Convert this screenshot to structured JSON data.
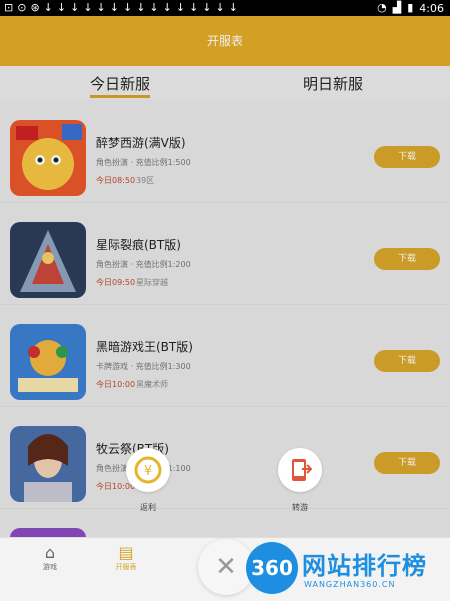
{
  "status_bar": {
    "time": "4:06"
  },
  "app_bar": {
    "title": "开服表"
  },
  "tabs": [
    {
      "label": "今日新服",
      "active": true
    },
    {
      "label": "明日新服",
      "active": false
    }
  ],
  "games": [
    {
      "name": "醉梦西游(满V版)",
      "subtitle": "角色扮演 · 充值比例1:500",
      "time": "今日08:50",
      "server": "39区",
      "button": "下载"
    },
    {
      "name": "星际裂痕(BT版)",
      "subtitle": "角色扮演 · 充值比例1:200",
      "time": "今日09:50",
      "server": "星际穿越",
      "button": "下载"
    },
    {
      "name": "黑暗游戏王(BT版)",
      "subtitle": "卡牌游戏 · 充值比例1:300",
      "time": "今日10:00",
      "server": "黑魔术师",
      "button": "下载"
    },
    {
      "name": "牧云祭(BT版)",
      "subtitle": "角色扮演 · 充值比例1:100",
      "time": "今日10:00",
      "server": "",
      "button": "下载"
    }
  ],
  "float_actions": [
    {
      "label": "返利",
      "icon": "yen-coin-icon"
    },
    {
      "label": "转游",
      "icon": "phone-transfer-icon"
    }
  ],
  "bottom_nav": [
    {
      "label": "游戏",
      "icon": "home-icon"
    },
    {
      "label": "开服表",
      "icon": "calendar-icon"
    }
  ],
  "watermark": {
    "logo": "360",
    "text": "网站排行榜",
    "sub": "WANGZHAN360.CN"
  },
  "colors": {
    "accent": "#e2a928",
    "button": "#d8a52a",
    "time_red": "#c24b2b",
    "brand_blue": "#1e8fe0"
  }
}
